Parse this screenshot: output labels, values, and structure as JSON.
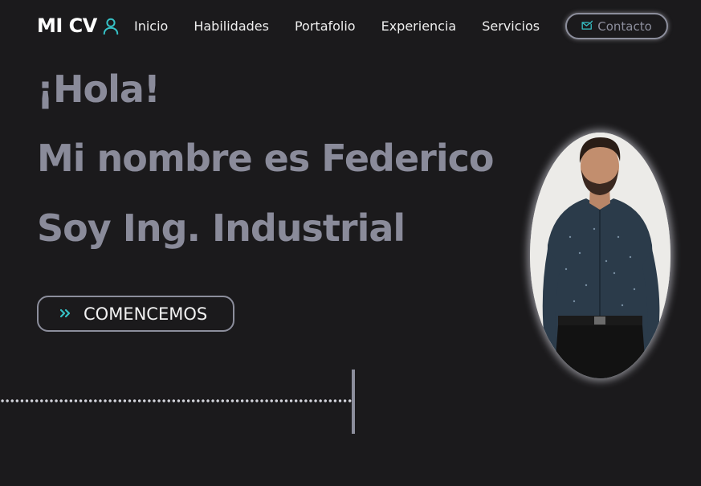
{
  "brand": {
    "title": "MI CV",
    "icon": "user-icon"
  },
  "nav": {
    "items": [
      "Inicio",
      "Habilidades",
      "Portafolio",
      "Experiencia",
      "Servicios"
    ],
    "contact_label": "Contacto",
    "contact_icon": "mail-check-icon"
  },
  "hero": {
    "greeting": "¡Hola!",
    "name_line": "Mi nombre es Federico",
    "role_line": "Soy Ing. Industrial",
    "cta_label": "COMENCEMOS",
    "cta_icon": "double-chevron-right-icon"
  },
  "colors": {
    "background": "#1b1a1c",
    "accent": "#36c1c6",
    "muted_text": "#8a8b9a",
    "border": "#8c8e9c"
  }
}
